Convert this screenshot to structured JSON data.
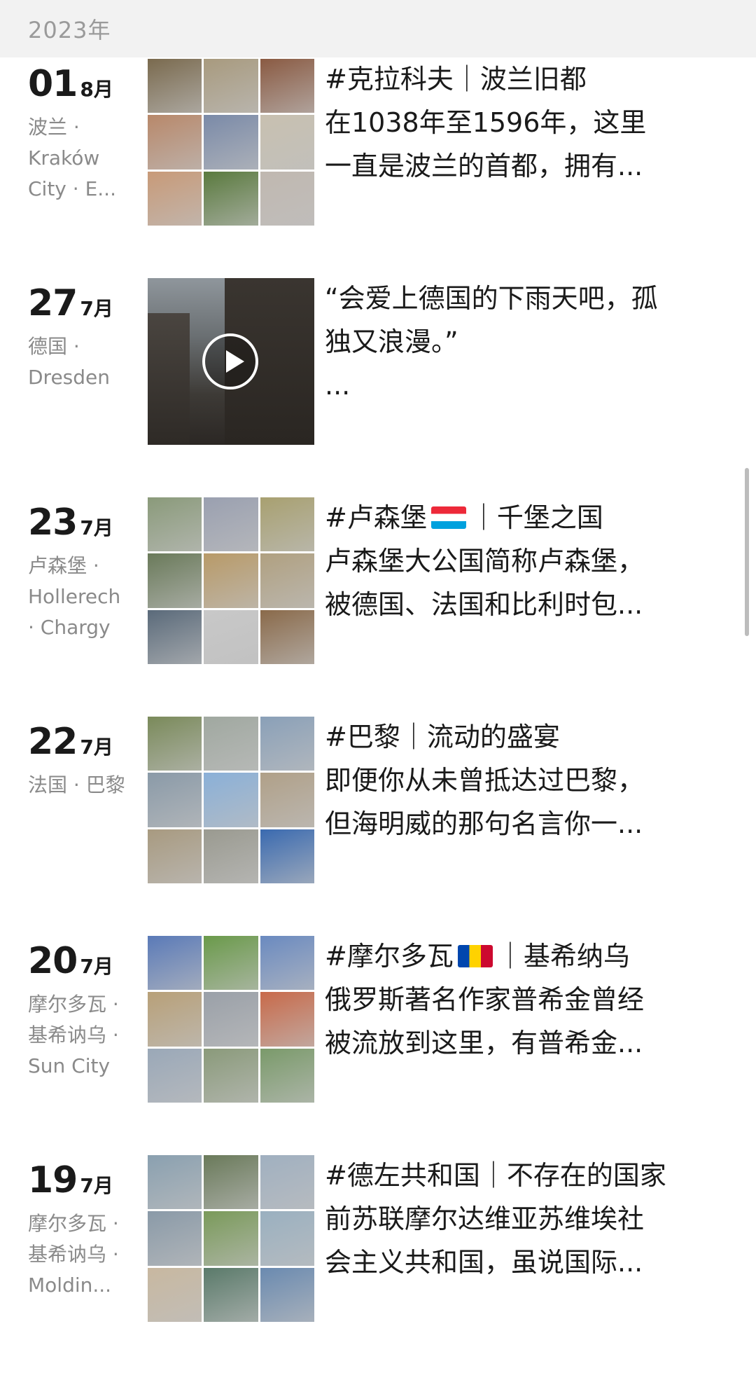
{
  "year_header": "2023年",
  "posts": [
    {
      "day": "01",
      "month": "8月",
      "location": "波兰 · Kraków City · E...",
      "lines": [
        "#克拉科夫｜波兰旧都",
        "在1038年至1596年，这里",
        "一直是波兰的首都，拥有..."
      ],
      "media_type": "photo-grid",
      "colors": [
        "#7a6a4e",
        "#a89a7e",
        "#8a5a42",
        "#b8886a",
        "#7a8aa8",
        "#c8c0b0",
        "#c89a78",
        "#5a7a3e",
        "#c0b8b0"
      ]
    },
    {
      "day": "27",
      "month": "7月",
      "location": "德国 · Dresden",
      "lines": [
        "“会爱上德国的下雨天吧，孤",
        "独又浪漫。”",
        "..."
      ],
      "media_type": "video"
    },
    {
      "day": "23",
      "month": "7月",
      "location": "卢森堡 · Hollerech · Chargy",
      "lines_before_flag": "#卢森堡",
      "flag": "lu",
      "lines_after_flag": "｜千堡之国",
      "lines": [
        "卢森堡大公国简称卢森堡，",
        "被德国、法国和比利时包..."
      ],
      "media_type": "photo-grid",
      "colors": [
        "#8a9a7a",
        "#9aa0b0",
        "#a8a070",
        "#6a7a5a",
        "#b89a68",
        "#b0a080",
        "#5a6a7a",
        "#c8c8c8",
        "#8a6a4a"
      ]
    },
    {
      "day": "22",
      "month": "7月",
      "location": "法国 · 巴黎",
      "lines": [
        "#巴黎｜流动的盛宴",
        "即便你从未曾抵达过巴黎，",
        "但海明威的那句名言你一..."
      ],
      "media_type": "photo-grid",
      "colors": [
        "#7a8a5a",
        "#a0a8a0",
        "#8aa0b8",
        "#8a9aa8",
        "#8ab0d8",
        "#b0a088",
        "#a89a80",
        "#9a9a90",
        "#3a6ab0"
      ]
    },
    {
      "day": "20",
      "month": "7月",
      "location": "摩尔多瓦 · 基希讷乌 · Sun City",
      "lines_before_flag": "#摩尔多瓦",
      "flag": "md",
      "lines_after_flag": "｜基希纳乌",
      "lines": [
        "俄罗斯著名作家普希金曾经",
        "被流放到这里，有普希金..."
      ],
      "media_type": "photo-grid",
      "colors": [
        "#5a7ab8",
        "#6a9a4a",
        "#6a8ac0",
        "#b8a078",
        "#9aa0a8",
        "#c86a4a",
        "#9aa8b8",
        "#8a9a7a",
        "#7a9a6a"
      ]
    },
    {
      "day": "19",
      "month": "7月",
      "location": "摩尔多瓦 · 基希讷乌 · Moldin...",
      "lines": [
        "#德左共和国｜不存在的国家",
        "前苏联摩尔达维亚苏维埃社",
        "会主义共和国，虽说国际..."
      ],
      "media_type": "photo-grid",
      "colors": [
        "#8aa0b0",
        "#6a7a5a",
        "#a0b0c0",
        "#8a9aa8",
        "#7a9a5a",
        "#9ab0c0",
        "#c8b8a0",
        "#5a7a6a",
        "#6a8ab0"
      ]
    }
  ]
}
